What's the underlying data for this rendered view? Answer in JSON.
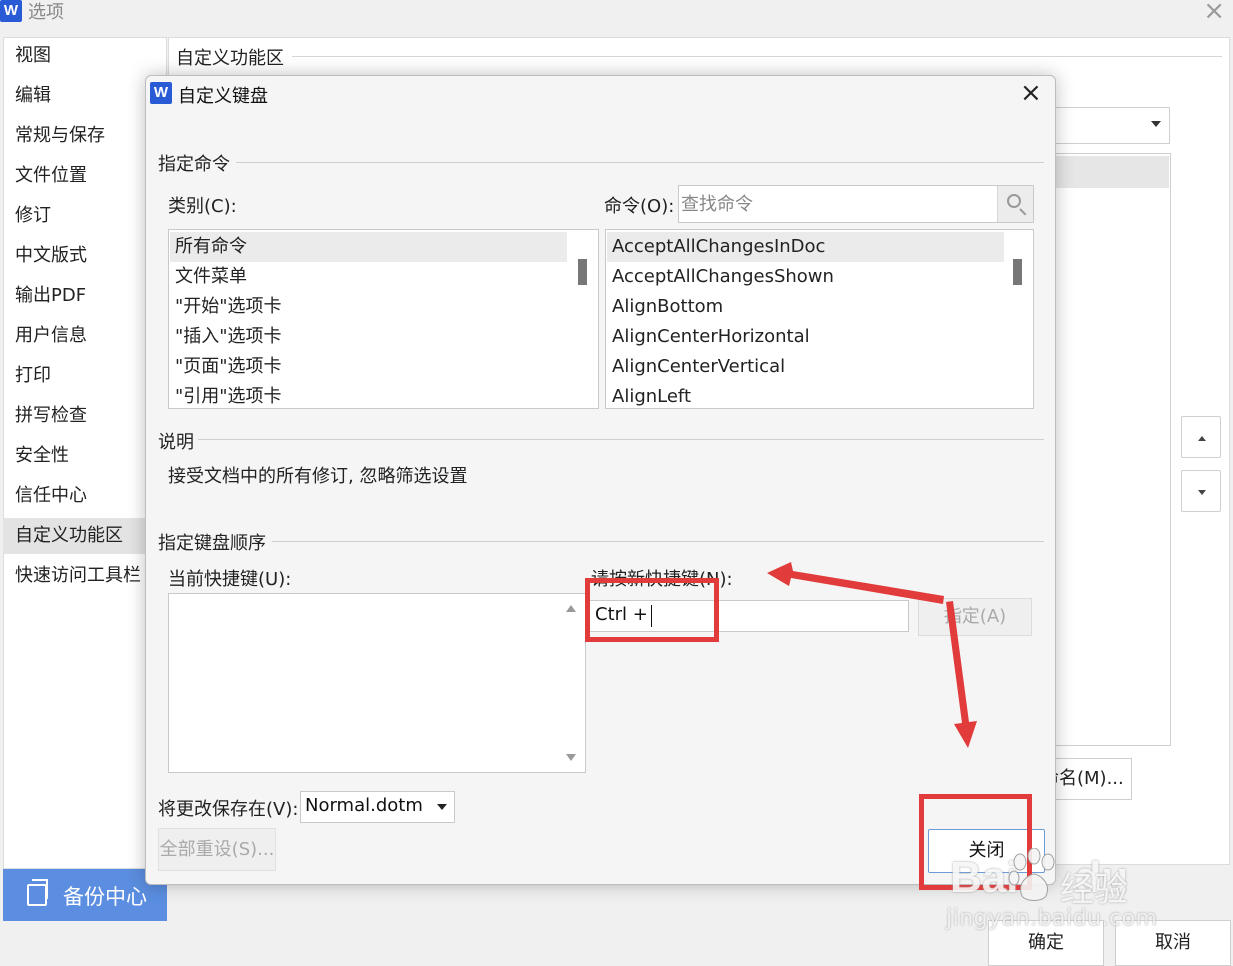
{
  "options_window": {
    "title": "选项",
    "logo_letter": "W",
    "close_glyph": "×",
    "nav_items": [
      "视图",
      "编辑",
      "常规与保存",
      "文件位置",
      "修订",
      "中文版式",
      "输出PDF",
      "用户信息",
      "打印",
      "拼写检查",
      "安全性",
      "信任中心",
      "自定义功能区",
      "快速访问工具栏"
    ],
    "active_nav": "自定义功能区",
    "backup_center": "备份中心",
    "section_heading": "自定义功能区",
    "rename_button": "命名(M)...",
    "ok_button": "确定",
    "cancel_button": "取消"
  },
  "dialog": {
    "title": "自定义键盘",
    "logo_letter": "W",
    "close_glyph": "×",
    "assign_section": "指定命令",
    "category_label": "类别(C):",
    "command_label": "命令(O):",
    "search_placeholder": "查找命令",
    "categories": [
      "所有命令",
      "文件菜单",
      "\"开始\"选项卡",
      "\"插入\"选项卡",
      "\"页面\"选项卡",
      "\"引用\"选项卡"
    ],
    "commands": [
      "AcceptAllChangesInDoc",
      "AcceptAllChangesShown",
      "AlignBottom",
      "AlignCenterHorizontal",
      "AlignCenterVertical",
      "AlignLeft"
    ],
    "description_section": "说明",
    "description_text": "接受文档中的所有修订, 忽略筛选设置",
    "key_sequence_section": "指定键盘顺序",
    "current_keys_label": "当前快捷键(U):",
    "new_key_label": "请按新快捷键(N):",
    "new_key_value": "Ctrl +",
    "assign_button": "指定(A)",
    "save_in_label": "将更改保存在(V):",
    "save_in_value": "Normal.dotm",
    "reset_all_button": "全部重设(S)...",
    "close_button": "关闭"
  },
  "annotations": {
    "highlight_color": "#e23b3b"
  },
  "watermark": {
    "brand": "Bai",
    "brand_suffix": "du",
    "service": "经验",
    "url": "jingyan.baidu.com"
  }
}
